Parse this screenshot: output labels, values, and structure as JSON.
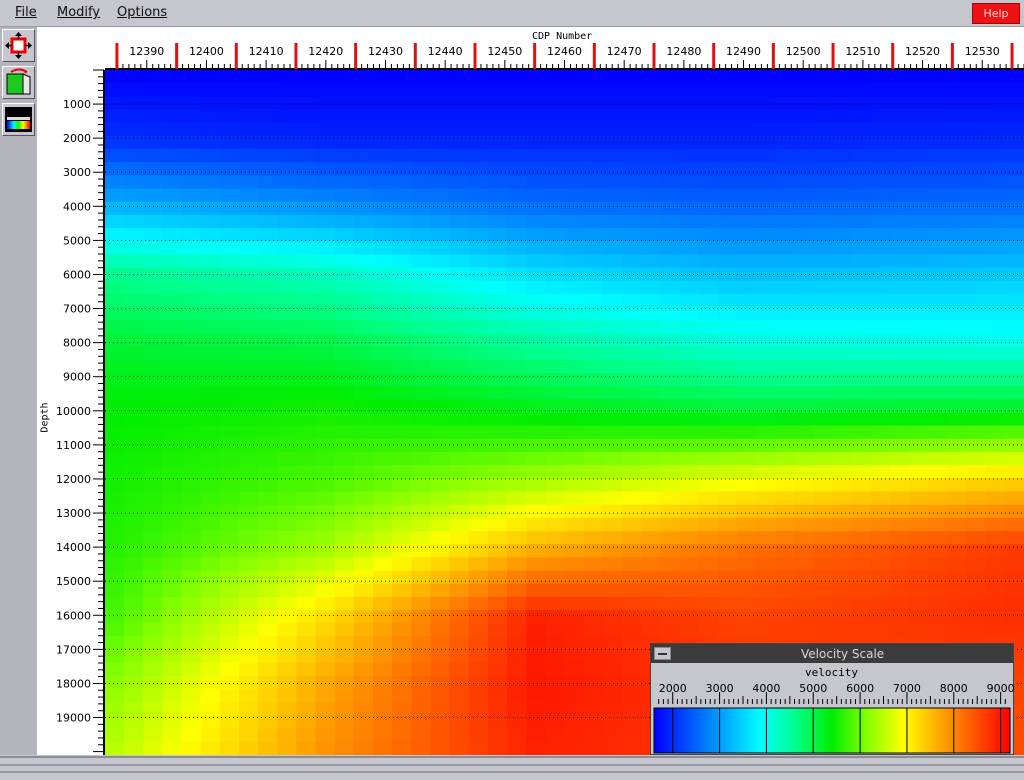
{
  "menu": {
    "file": "File",
    "modify": "Modify",
    "options": "Options",
    "help": "Help"
  },
  "toolbar": {
    "icons": [
      "move-arrows-icon",
      "page-flip-icon",
      "color-scale-icon"
    ]
  },
  "axes": {
    "x_title": "CDP Number",
    "y_title": "Depth",
    "x_ticks": [
      "12390",
      "12400",
      "12410",
      "12420",
      "12430",
      "12440",
      "12450",
      "12460",
      "12470",
      "12480",
      "12490",
      "12500",
      "12510",
      "12520",
      "12530"
    ],
    "y_ticks": [
      "1000",
      "2000",
      "3000",
      "4000",
      "5000",
      "6000",
      "7000",
      "8000",
      "9000",
      "10000",
      "11000",
      "12000",
      "13000",
      "14000",
      "15000",
      "16000",
      "17000",
      "18000",
      "19000"
    ]
  },
  "velocity_scale": {
    "window_title": "Velocity Scale",
    "label": "velocity",
    "ticks": [
      "2000",
      "3000",
      "4000",
      "5000",
      "6000",
      "7000",
      "8000",
      "9000"
    ]
  },
  "colors": {
    "menubar": "#c6c6ce",
    "help_button": "#ee1111",
    "tick_marker": "#dd1111",
    "colormap": [
      "#0000ff",
      "#0055ff",
      "#00aaff",
      "#00ffff",
      "#00ff88",
      "#00ee00",
      "#88ff00",
      "#ffff00",
      "#ffaa00",
      "#ff5500",
      "#ff0000"
    ]
  },
  "chart_data": {
    "type": "heatmap",
    "xlabel": "CDP Number",
    "ylabel": "Depth",
    "xlim": [
      12383,
      12537
    ],
    "ylim": [
      0,
      20100
    ],
    "colorbar": {
      "label": "velocity",
      "range": [
        1600,
        9200
      ]
    },
    "x": [
      12385,
      12420,
      12455,
      12490,
      12537
    ],
    "y": [
      0,
      2000,
      4000,
      6000,
      8000,
      10000,
      12000,
      14000,
      16000,
      18000,
      20100
    ],
    "values": [
      [
        1600,
        1600,
        1600,
        1600,
        1600
      ],
      [
        2000,
        1900,
        1900,
        1900,
        1950
      ],
      [
        3200,
        2900,
        2600,
        2500,
        2600
      ],
      [
        4600,
        4300,
        3600,
        3300,
        3400
      ],
      [
        5100,
        5000,
        4500,
        4100,
        4000
      ],
      [
        5400,
        5500,
        5300,
        5100,
        5200
      ],
      [
        5500,
        5800,
        6300,
        6800,
        7300
      ],
      [
        5600,
        6300,
        7600,
        8200,
        8700
      ],
      [
        5800,
        7200,
        8900,
        8600,
        8800
      ],
      [
        6200,
        7700,
        9000,
        8700,
        8600
      ],
      [
        6500,
        7900,
        8900,
        8700,
        8500
      ]
    ]
  }
}
